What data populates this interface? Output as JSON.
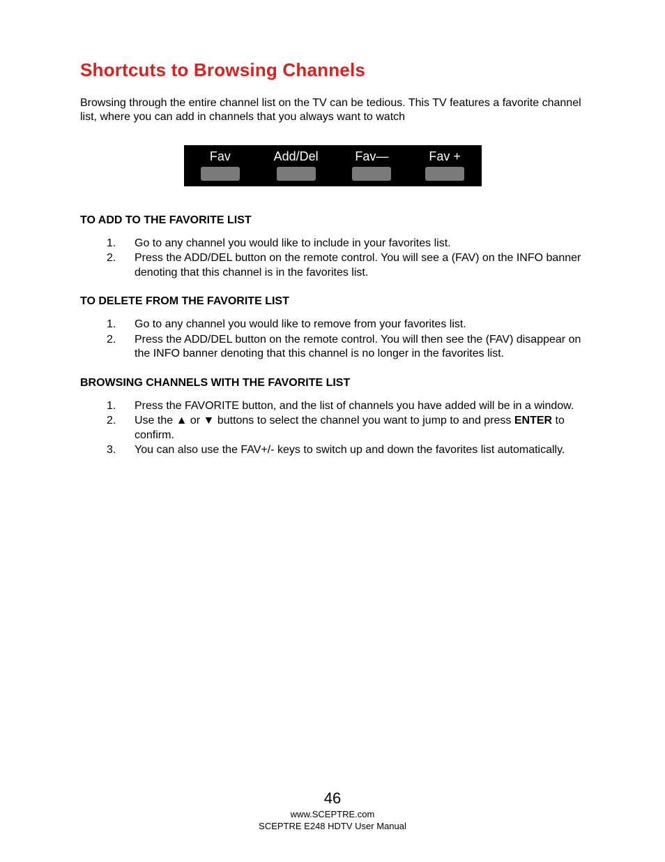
{
  "heading": "Shortcuts to Browsing Channels",
  "intro": "Browsing through the entire channel list on the TV can be tedious.  This TV features a favorite channel list, where you can add in channels that you always want to watch",
  "remote_buttons": {
    "fav": "Fav",
    "adddel": "Add/Del",
    "favminus": "Fav—",
    "favplus": "Fav +"
  },
  "sections": {
    "add": {
      "heading": "TO ADD TO THE FAVORITE LIST",
      "items": [
        "Go to any channel you would like to include in your favorites list.",
        "Press the ADD/DEL button on the remote control.  You will see a (FAV) on the INFO banner denoting that this channel is in the favorites list."
      ]
    },
    "delete": {
      "heading": "TO DELETE FROM THE FAVORITE LIST",
      "items": [
        "Go to any channel you would like to remove from your favorites list.",
        "Press the ADD/DEL button on the remote control.  You will then see the (FAV) disappear on the INFO banner denoting that this channel is no longer in the favorites list."
      ]
    },
    "browse": {
      "heading": "BROWSING CHANNELS WITH THE FAVORITE LIST",
      "items": {
        "i1": "Press the FAVORITE button, and the list of channels you have added will be in a window.",
        "i2a": "Use the ▲ or ▼ buttons to select the channel you want to jump to and press ",
        "i2b_bold": "ENTER",
        "i2c": " to confirm.",
        "i3": "You can also use the FAV+/- keys to switch up and down the favorites list automatically."
      }
    }
  },
  "footer": {
    "page_number": "46",
    "url": "www.SCEPTRE.com",
    "manual": "SCEPTRE E248 HDTV User Manual"
  }
}
